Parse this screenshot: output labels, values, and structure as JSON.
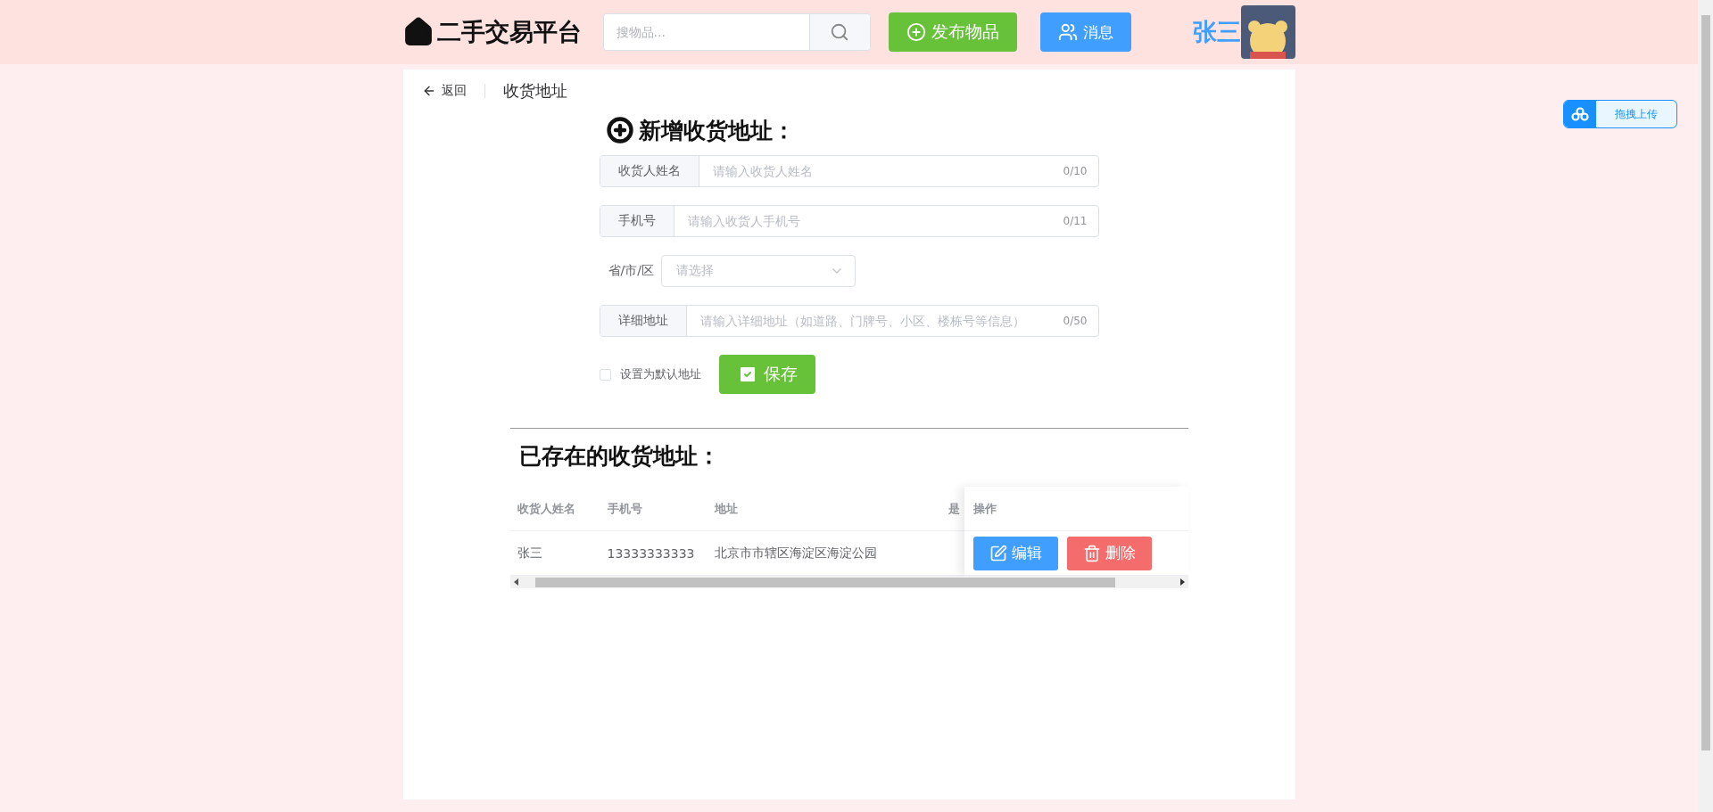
{
  "header": {
    "logo": "二手交易平台",
    "search": {
      "placeholder": "搜物品..."
    },
    "buttons": [
      {
        "kind": "publish",
        "label": "发布物品"
      },
      {
        "kind": "message",
        "label": "消息"
      }
    ],
    "user": {
      "name": "张三"
    }
  },
  "page_header": {
    "back": "返回",
    "title": "收货地址"
  },
  "form": {
    "title": "新增收货地址：",
    "fields": [
      {
        "kind": "text",
        "label": "收货人姓名",
        "placeholder": "请输入收货人姓名",
        "count": "0/10"
      },
      {
        "kind": "text",
        "label": "手机号",
        "placeholder": "请输入收货人手机号",
        "count": "0/11"
      },
      {
        "kind": "select",
        "label": "省/市/区",
        "placeholder": "请选择"
      },
      {
        "kind": "text",
        "label": "详细地址",
        "placeholder": "请输入详细地址（如道路、门牌号、小区、楼栋号等信息）",
        "count": "0/50"
      }
    ],
    "default": {
      "label": "设置为默认地址",
      "checked": false
    },
    "save": "保存"
  },
  "addresses": {
    "title": "已存在的收货地址：",
    "columns": [
      "收货人姓名",
      "手机号",
      "地址",
      "是"
    ],
    "action_column": "操作",
    "rows": [
      {
        "cells": [
          "张三",
          "13333333333",
          "北京市市辖区海淀区海淀公园"
        ],
        "actions": [
          {
            "kind": "edit",
            "label": "编辑"
          },
          {
            "kind": "delete",
            "label": "删除"
          }
        ]
      }
    ]
  },
  "upload": {
    "label": "拖拽上传"
  }
}
